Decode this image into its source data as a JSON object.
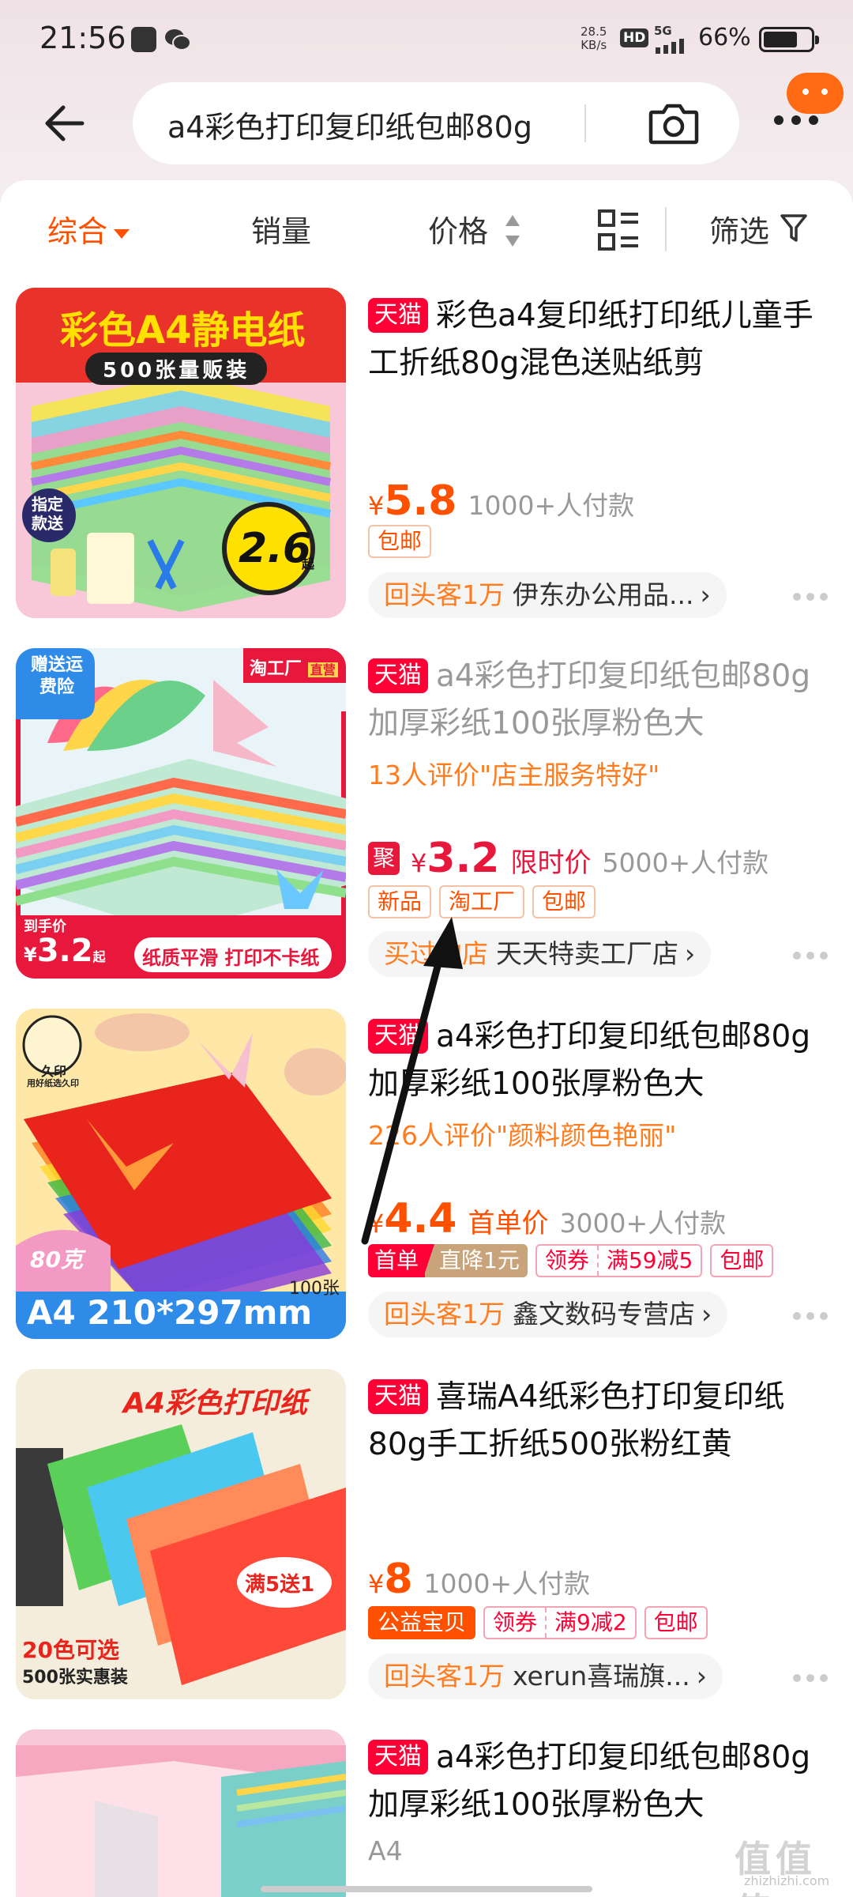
{
  "status_bar": {
    "time": "21:56",
    "speed_top": "28.5",
    "speed_unit": "KB/s",
    "hd": "HD",
    "network": "5G",
    "battery": "66%"
  },
  "header": {
    "search_text": "a4彩色打印复印纸包邮80g",
    "icons": [
      "back-arrow-icon",
      "camera-icon",
      "more-icon",
      "message-icon"
    ]
  },
  "filters": {
    "items": [
      "综合",
      "销量",
      "价格",
      "筛选"
    ],
    "active_index": 0
  },
  "products": [
    {
      "shop_tag": "天猫",
      "title": "彩色a4复印纸打印纸儿童手工折纸80g混色送贴纸剪",
      "yen": "¥",
      "price": "5.8",
      "sold": "1000+人付款",
      "tags": [
        "包邮"
      ],
      "shop_highlight": "回头客1万",
      "shop_name": "伊东办公用品...",
      "image": {
        "headline": "彩色A4静电纸",
        "subline": "500张量贩装",
        "badge": "指定款送",
        "price_badge": "2.6",
        "price_badge_unit": "起"
      }
    },
    {
      "shop_tag": "天猫",
      "title": "a4彩色打印复印纸包邮80g加厚彩纸100张厚粉色大",
      "review": "13人评价\"店主服务特好\"",
      "ju": "聚",
      "yen": "¥",
      "price": "3.2",
      "price_label": "限时价",
      "sold": "5000+人付款",
      "tags": [
        "新品",
        "淘工厂",
        "包邮"
      ],
      "shop_highlight": "买过的店",
      "shop_name": "天天特卖工厂店",
      "image": {
        "corner_badge": "赠送运费险",
        "factory_badge": "淘工厂",
        "factory_badge_sub": "直营",
        "hand_price_label": "到手价",
        "hand_price_yen": "¥",
        "hand_price": "3.2",
        "hand_price_unit": "起",
        "footer": "纸质平滑 打印不卡纸"
      }
    },
    {
      "shop_tag": "天猫",
      "title": "a4彩色打印复印纸包邮80g加厚彩纸100张厚粉色大",
      "review": "226人评价\"颜料颜色艳丽\"",
      "yen": "¥",
      "price": "4.4",
      "price_label": "首单价",
      "sold": "3000+人付款",
      "tag_shoudan_a": "首单",
      "tag_shoudan_b": "直降1元",
      "coupon_left": "领券",
      "coupon_right": "满59减5",
      "tags_after": [
        "包邮"
      ],
      "shop_highlight": "回头客1万",
      "shop_name": "鑫文数码专营店",
      "image": {
        "brand": "久印",
        "brand_sub": "用好纸选久印",
        "weight": "80克",
        "count": "100张",
        "size": "A4 210*297mm"
      }
    },
    {
      "shop_tag": "天猫",
      "title": "喜瑞A4纸彩色打印复印纸80g手工折纸500张粉红黄",
      "yen": "¥",
      "price": "8",
      "sold": "1000+人付款",
      "tag_gongyi": "公益宝贝",
      "coupon_left": "领券",
      "coupon_right": "满9减2",
      "tags_after": [
        "包邮"
      ],
      "shop_highlight": "回头客1万",
      "shop_name": "xerun喜瑞旗...",
      "image": {
        "headline": "A4彩色打印纸",
        "promo": "满5送1",
        "colors": "20色可选",
        "count": "500张实惠装"
      }
    },
    {
      "shop_tag": "天猫",
      "title": "a4彩色打印复印纸包邮80g加厚彩纸100张厚粉色大",
      "sub": "A4"
    }
  ],
  "watermark": {
    "text": "值值值",
    "site": "zhizhizhi.com"
  },
  "colors": {
    "accent": "#ff5000",
    "tmall": "#ff0036",
    "review": "#ff7c1f"
  }
}
